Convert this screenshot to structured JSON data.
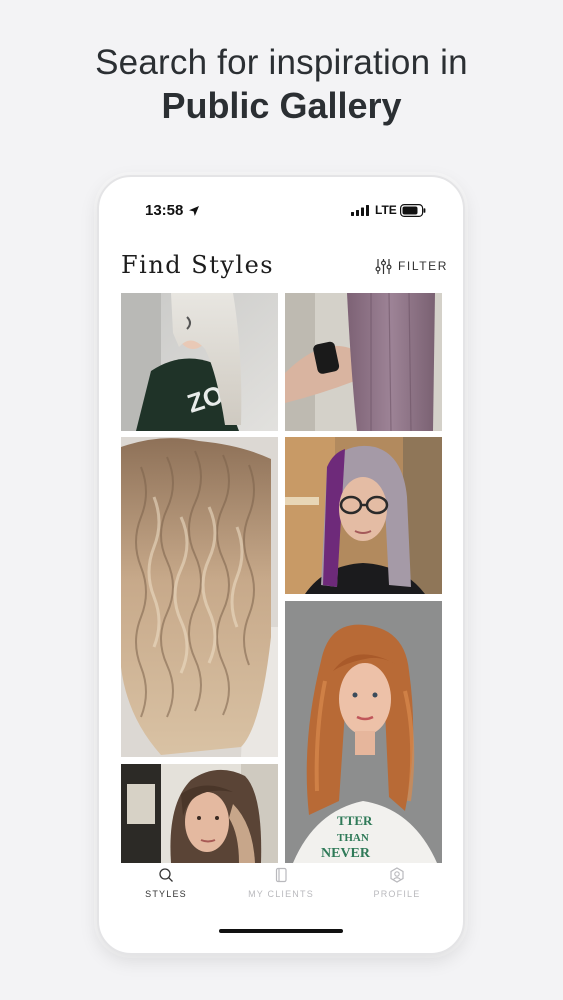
{
  "promo": {
    "line1": "Search for inspiration in",
    "line2": "Public Gallery"
  },
  "status_bar": {
    "time": "13:58",
    "network": "LTE",
    "icons": [
      "location-arrow-icon",
      "signal-icon",
      "battery-icon"
    ]
  },
  "header": {
    "title": "Find Styles",
    "filter_label": "FILTER",
    "filter_icon": "sliders-icon"
  },
  "gallery": {
    "photos": [
      "platinum-blonde-straight-hair",
      "lavender-long-straight-hair",
      "sandy-blonde-wavy-hair",
      "purple-silver-lob-with-glasses",
      "copper-red-long-waves",
      "brunette-balayage"
    ]
  },
  "tabbar": {
    "tabs": [
      {
        "label": "STYLES",
        "icon": "search-icon",
        "active": true
      },
      {
        "label": "MY CLIENTS",
        "icon": "clients-icon",
        "active": false
      },
      {
        "label": "PROFILE",
        "icon": "profile-icon",
        "active": false
      }
    ]
  },
  "colors": {
    "background": "#f3f3f5",
    "headline_text": "#2b2f33",
    "active_tab": "#333333",
    "inactive_tab": "#b9b9bd"
  }
}
